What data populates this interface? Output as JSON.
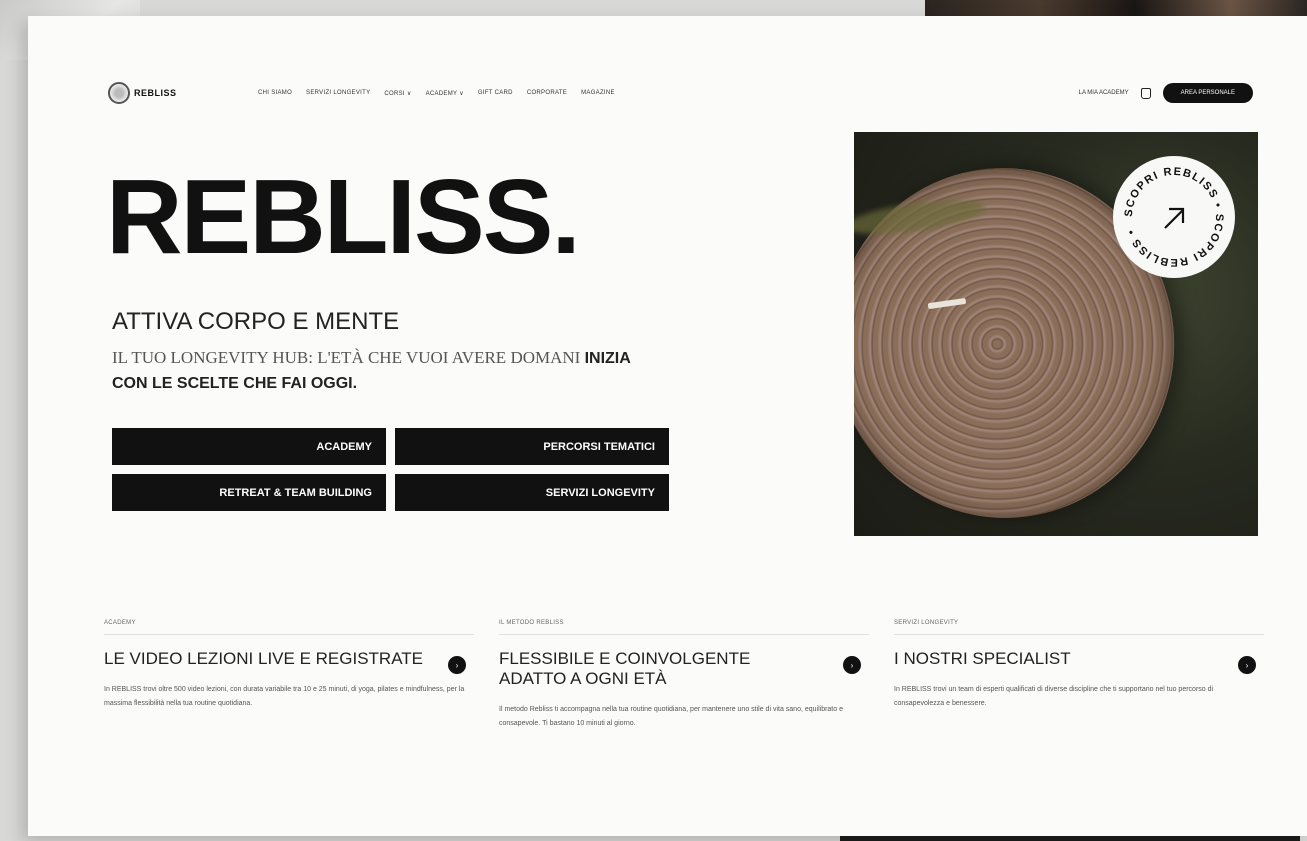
{
  "brand": {
    "name": "REBLISS"
  },
  "nav": {
    "links": [
      "CHI SIAMO",
      "SERVIZI LONGEVITY",
      "CORSI ∨",
      "ACADEMY ∨",
      "GIFT CARD",
      "CORPORATE",
      "MAGAZINE"
    ],
    "login": "LA MIA ACADEMY",
    "cta": "AREA PERSONALE"
  },
  "hero": {
    "title": "REBLISS.",
    "subtitle": "ATTIVA CORPO E MENTE",
    "text_light": "IL TUO LONGEVITY HUB: L'ETÀ CHE VUOI AVERE DOMANI",
    "text_bold": "INIZIA CON LE SCELTE CHE FAI OGGI.",
    "buttons": [
      "ACADEMY",
      "PERCORSI TEMATICI",
      "RETREAT & TEAM BUILDING",
      "SERVIZI LONGEVITY"
    ],
    "badge_text": "SCOPRI REBLISS • SCOPRI REBLISS • ",
    "badge_icon": "arrow-up-right-icon"
  },
  "cards": [
    {
      "category": "ACADEMY",
      "title": "LE VIDEO LEZIONI LIVE E REGISTRATE",
      "description": "In REBLISS trovi oltre 500 video lezioni, con durata variabile tra 10 e 25 minuti, di yoga, pilates e mindfulness, per la massima flessibilità nella tua routine quotidiana."
    },
    {
      "category": "IL METODO REBLISS",
      "title": "FLESSIBILE E COINVOLGENTE ADATTO A OGNI ETÀ",
      "description": "Il metodo Rebliss ti accompagna nella tua routine quotidiana, per mantenere uno stile di vita sano, equilibrato e consapevole. Ti bastano 10 minuti al giorno."
    },
    {
      "category": "SERVIZI LONGEVITY",
      "title": "I NOSTRI SPECIALIST",
      "description": "In REBLISS trovi un team di esperti qualificati di diverse discipline che ti supportano nel tuo percorso di consapevolezza e benessere."
    }
  ]
}
